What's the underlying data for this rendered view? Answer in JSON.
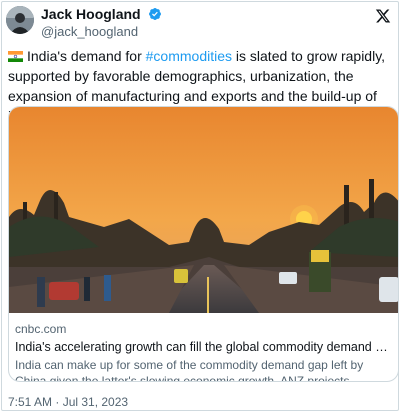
{
  "author": {
    "display_name": "Jack Hoogland",
    "handle": "@jack_hoogland",
    "verified": true,
    "avatar_icon": "profile-photo",
    "brand_icon": "x-logo-icon"
  },
  "tweet": {
    "flag_icon": "india-flag-emoji",
    "text_before": "India's demand for ",
    "hashtag": "#commodities",
    "text_after": " is slated to grow rapidly, supported by favorable demographics, urbanization, the expansion of manufacturing and exports and the build-up of infrastructure."
  },
  "card": {
    "domain": "cnbc.com",
    "title": "India's accelerating growth can fill the global commodity demand gap left by ...",
    "description": "India can make up for some of the commodity demand gap left by China given the latter's slowing economic growth, ANZ projects."
  },
  "timestamp": "7:51 AM · Jul 31, 2023",
  "colors": {
    "link": "#1d9bf0",
    "verified": "#1d9bf0",
    "text": "#0f1419",
    "secondary": "#536471",
    "border": "#cfd9de"
  }
}
